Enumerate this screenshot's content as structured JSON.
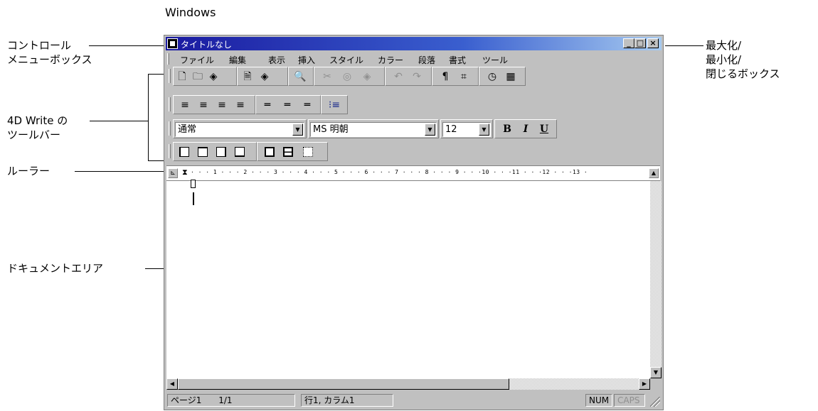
{
  "heading": "Windows",
  "callouts": {
    "control_menu_line1": "コントロール",
    "control_menu_line2": "メニューボックス",
    "toolbar_line1": "4D Write の",
    "toolbar_line2": "ツールバー",
    "ruler": "ルーラー",
    "document_area": "ドキュメントエリア",
    "window_buttons_line1": "最大化/",
    "window_buttons_line2": "最小化/",
    "window_buttons_line3": "閉じるボックス"
  },
  "window": {
    "title": "タイトルなし",
    "minimize_glyph": "_",
    "maximize_glyph": "□",
    "close_glyph": "×"
  },
  "menu": [
    "ファイル",
    "編集",
    "表示",
    "挿入",
    "スタイル",
    "カラー",
    "段落",
    "書式",
    "ツール"
  ],
  "toolbar1_icons": [
    "new-doc-icon",
    "open-folder-icon",
    "save-icon",
    "print-preview-icon",
    "print-icon",
    "find-icon",
    "cut-icon",
    "copy-icon",
    "paste-icon",
    "undo-icon",
    "redo-icon",
    "pilcrow-icon",
    "field-icon",
    "clock-icon",
    "calendar-icon"
  ],
  "toolbar1_glyphs": [
    "🗋",
    "🗀",
    "◈",
    "🗎",
    "◈",
    "🔍",
    "✂",
    "◎",
    "◈",
    "↶",
    "↷",
    "¶",
    "⌗",
    "◷",
    "▦"
  ],
  "toolbar2_glyphs": [
    "≡",
    "≡",
    "≡",
    "≡",
    "═",
    "═",
    "═",
    "⁝≡"
  ],
  "format": {
    "style_value": "通常",
    "font_value": "MS 明朝",
    "size_value": "12",
    "bold": "B",
    "italic": "I",
    "underline": "U"
  },
  "ruler": {
    "corner_glyph": "⊾",
    "ticks": "· · · 1 · · · 2 · · · 3 · · · 4 · · · 5 · · · 6 · · · 7 · · · 8 · · · 9 · · ·10 · · ·11 · · ·12 · · ·13 ·"
  },
  "statusbar": {
    "page": "ページ1",
    "pages": "1/1",
    "position": "行1, カラム1",
    "num": "NUM",
    "caps": "CAPS"
  }
}
